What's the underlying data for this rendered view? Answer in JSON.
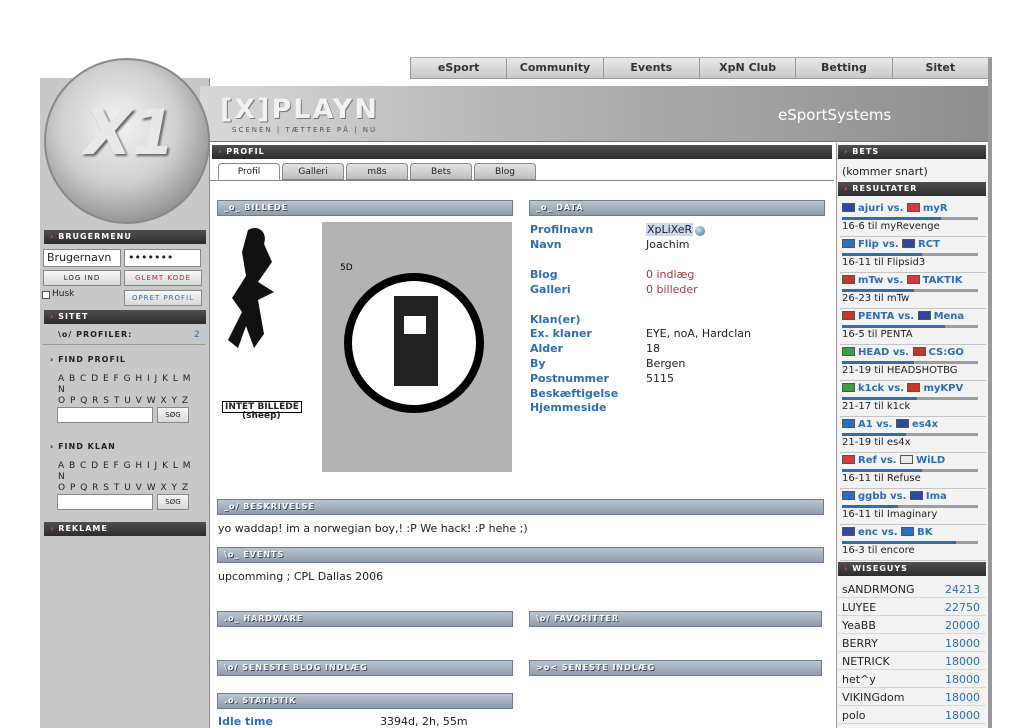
{
  "nav": {
    "items": [
      "eSport",
      "Community",
      "Events",
      "XpN Club",
      "Betting",
      "Sitet"
    ]
  },
  "banner": {
    "logo": "[X]PLAYN",
    "tagline": "SCENEN | TÆTTERE PÅ | NU",
    "brand": "eSportSystems",
    "orb_letter": "X1"
  },
  "left": {
    "user_menu_title": "BRUGERMENU",
    "username_placeholder": "Brugernavn",
    "password_value": "•••••••",
    "login_label": "LOG IND",
    "forgot_label": "GLEMT KODE",
    "remember_label": "Husk",
    "create_label": "OPRET PROFIL",
    "site_title": "SITET",
    "profiles_label": "\\o/ PROFILER:",
    "profiles_count": "2",
    "find_profile_title": "FIND PROFIL",
    "letters_row1": "A B C D E F G H I J K L M N",
    "letters_row2": "O P Q R S T U V W X Y Z",
    "search_button": "SØG",
    "find_clan_title": "FIND KLAN",
    "ads_title": "REKLAME"
  },
  "profile": {
    "title": "PROFIL",
    "tabs": [
      "Profil",
      "Galleri",
      "m8s",
      "Bets",
      "Blog"
    ],
    "picture_title": "BILLEDE",
    "picture_caption1": "INTET BILLEDE",
    "picture_caption2": "(sheep)",
    "data_title": "DATA",
    "fields": [
      {
        "label": "Profilnavn",
        "value": "XpLiXeR"
      },
      {
        "label": "Navn",
        "value": "Joachim"
      },
      {
        "label": "Blog",
        "value": "0 indlæg"
      },
      {
        "label": "Galleri",
        "value": "0 billeder"
      },
      {
        "label": "Klan(er)",
        "value": ""
      },
      {
        "label": "Ex. klaner",
        "value": "EYE, noA, Hardclan"
      },
      {
        "label": "Alder",
        "value": "18"
      },
      {
        "label": "By",
        "value": "Bergen"
      },
      {
        "label": "Postnummer",
        "value": "5115"
      },
      {
        "label": "Beskæftigelse",
        "value": ""
      },
      {
        "label": "Hjemmeside",
        "value": ""
      }
    ],
    "description_title": "BESKRIVELSE",
    "description": "yo waddap! im a norwegian boy,! :P We hack! :P hehe ;)",
    "events_title": "EVENTS",
    "events": "upcomming ; CPL Dallas 2006",
    "hardware_title": "HARDWARE",
    "favorites_title": "FAVORITTER",
    "latest_blog_title": "SENESTE BLOG INDLÆG",
    "latest_posts_title": "SENESTE INDLÆG",
    "stats_title": "STATISTIK",
    "idle_label": "Idle time",
    "idle_value": "3394d, 2h, 55m"
  },
  "right": {
    "bets_title": "BETS",
    "bets_text": "(kommer snart)",
    "results_title": "RESULTATER",
    "matches": [
      {
        "team1": "ajuri",
        "team2": "myR",
        "result": "16-6 til myRevenge",
        "flag1": "#2c4a9e",
        "flag2": "#d23c3c",
        "share": 0.73
      },
      {
        "team1": "Flip",
        "team2": "RCT",
        "result": "16-11 til Flipsid3",
        "flag1": "#2c6fc0",
        "flag2": "#2c4a9e",
        "share": 0.59
      },
      {
        "team1": "mTw",
        "team2": "TAKTIK",
        "result": "26-23 til mTw",
        "flag1": "#c0392b",
        "flag2": "#d23c3c",
        "share": 0.53
      },
      {
        "team1": "PENTA",
        "team2": "Mena",
        "result": "16-5 til PENTA",
        "flag1": "#c0392b",
        "flag2": "#2c4a9e",
        "share": 0.76
      },
      {
        "team1": "HEAD",
        "team2": "CS:GO",
        "result": "21-19 til HEADSHOTBG",
        "flag1": "#3a9e4a",
        "flag2": "#c0392b",
        "share": 0.53
      },
      {
        "team1": "k1ck",
        "team2": "myKPV",
        "result": "21-17 til k1ck",
        "flag1": "#3a9e4a",
        "flag2": "#c0392b",
        "share": 0.55
      },
      {
        "team1": "A1",
        "team2": "es4x",
        "result": "21-19 til es4x",
        "flag1": "#2c6fc0",
        "flag2": "#2c4a9e",
        "share": 0.47
      },
      {
        "team1": "Ref",
        "team2": "WiLD",
        "result": "16-11 til Refuse",
        "flag1": "#d23c3c",
        "flag2": "#e8e8e8",
        "share": 0.59
      },
      {
        "team1": "ggbb",
        "team2": "Ima",
        "result": "16-11 til Imaginary",
        "flag1": "#2c6fc0",
        "flag2": "#2c4a9e",
        "share": 0.41
      },
      {
        "team1": "enc",
        "team2": "BK",
        "result": "16-3 til encore",
        "flag1": "#2c4a9e",
        "flag2": "#2c6fc0",
        "share": 0.84
      }
    ],
    "vs_label": "vs.",
    "wiseguys_title": "WISEGUYS",
    "wiseguys": [
      {
        "name": "sANDRMONG",
        "score": "24213"
      },
      {
        "name": "LUYEE",
        "score": "22750"
      },
      {
        "name": "YeaBB",
        "score": "20000"
      },
      {
        "name": "BERRY",
        "score": "18000"
      },
      {
        "name": "NETRICK",
        "score": "18000"
      },
      {
        "name": "het^y",
        "score": "18000"
      },
      {
        "name": "VIKINGdom",
        "score": "18000"
      },
      {
        "name": "polo",
        "score": "18000"
      }
    ]
  }
}
